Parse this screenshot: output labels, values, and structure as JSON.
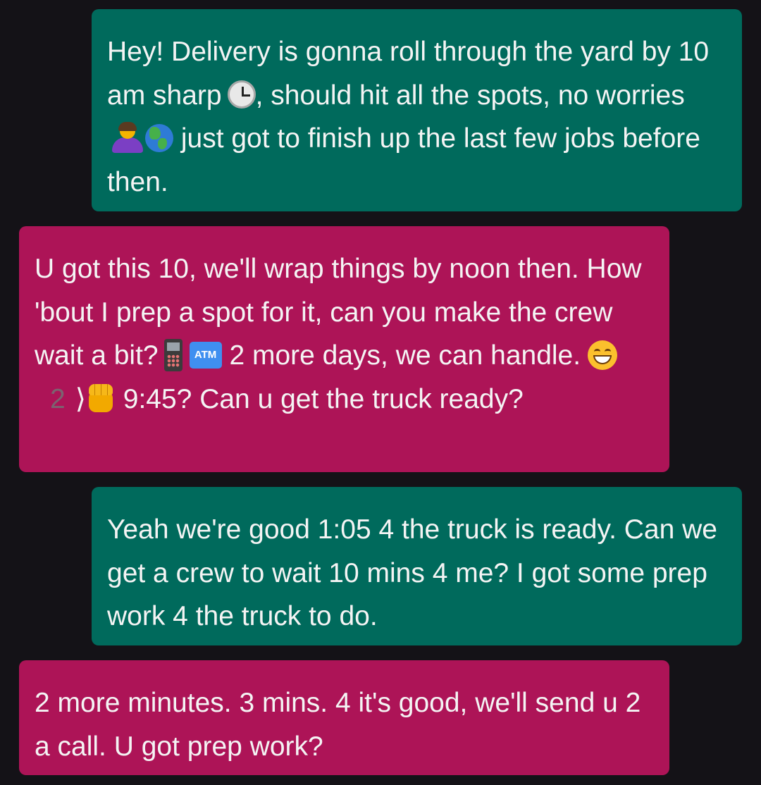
{
  "conversation": {
    "messages": [
      {
        "direction": "outgoing",
        "color": "#006a5c",
        "parts": [
          "Hey! Delivery is gonna roll through the yard by 10 am sharp",
          ", should hit all the spots, no worries",
          " just got to finish up the last few jobs before then."
        ],
        "emojis": [
          "clock-icon",
          "person-gesturing-no-icon",
          "globe-americas-icon"
        ]
      },
      {
        "direction": "incoming",
        "color": "#ad1457",
        "parts": [
          "U got this 10, we'll wrap things by noon then. How 'bout I prep a spot for it, can you make the crew wait a bit?",
          "2 more days, we can handle.",
          "2",
          "⟩",
          " 9:45? Can u get the truck ready?"
        ],
        "emojis": [
          "mobile-phone-icon",
          "atm-sign-icon",
          "grinning-face-icon",
          "oncoming-fist-icon"
        ],
        "atm_label": "ATM"
      },
      {
        "direction": "outgoing",
        "color": "#006a5c",
        "text": "Yeah we're good 1:05 4 the truck is ready. Can we get a crew to wait 10 mins 4 me? I got some prep work 4 the truck to do."
      },
      {
        "direction": "incoming",
        "color": "#ad1457",
        "text": "2 more minutes. 3 mins. 4 it's good, we'll send u 2 a call. U got prep work?"
      }
    ]
  }
}
